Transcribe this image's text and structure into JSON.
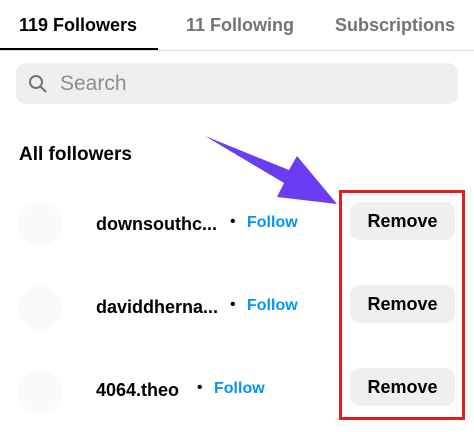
{
  "tabs": {
    "followers": "119 Followers",
    "following": "11 Following",
    "subscriptions": "Subscriptions"
  },
  "search": {
    "placeholder": "Search",
    "value": ""
  },
  "section": {
    "title": "All followers"
  },
  "followers": [
    {
      "username": "downsouthc...",
      "separator": "•",
      "follow_label": "Follow",
      "remove_label": "Remove"
    },
    {
      "username": "daviddherna...",
      "separator": "•",
      "follow_label": "Follow",
      "remove_label": "Remove"
    },
    {
      "username": "4064.theo",
      "separator": "•",
      "follow_label": "Follow",
      "remove_label": "Remove"
    }
  ],
  "colors": {
    "accent_link": "#0095f6",
    "highlight_box": "#e0201c",
    "annotation_arrow": "#6b3df2",
    "button_bg": "#efefef"
  },
  "icons": {
    "search": "search-icon",
    "arrow": "arrow-annotation-icon"
  }
}
